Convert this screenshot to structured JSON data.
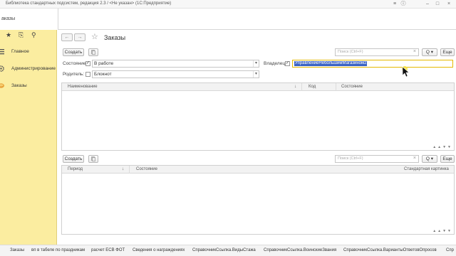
{
  "window": {
    "title": "Библиотека стандартных подсистем, редакция 2.3 / <Не указан> (1С:Предприятие)"
  },
  "tab": {
    "label": "аказы"
  },
  "sidebar": {
    "items": [
      {
        "label": "Главное",
        "icon": "menu-lines-icon"
      },
      {
        "label": "Администрирование",
        "icon": "gear-icon"
      },
      {
        "label": "Заказы",
        "icon": "orders-icon"
      }
    ]
  },
  "page": {
    "title": "Заказы",
    "create_label": "Создать",
    "search_placeholder": "Поиск (Ctrl+F)",
    "search_button": "Q",
    "more_label": "Еще"
  },
  "filters": {
    "state": {
      "label": "Состояние:",
      "checked": true,
      "value": "В работе"
    },
    "owner": {
      "label": "Владелец:",
      "checked": true,
      "value": "УправлениеНебольшимМагазином2"
    },
    "parent": {
      "label": "Родитель:",
      "checked": false,
      "value": "Блокнот"
    }
  },
  "table1": {
    "columns": [
      "Наименование",
      "Код",
      "Состояние"
    ]
  },
  "table2": {
    "create_label": "Создать",
    "search_placeholder": "Поиск (Ctrl+F)",
    "search_button": "Q",
    "more_label": "Еще",
    "columns": [
      "Период",
      "Состояние",
      "Стандартная картинка"
    ]
  },
  "bottom_links": [
    "Заказы",
    "вп в табеле по праздникам",
    "расчет ЕСВ ФОТ",
    "Сведения о награждениях",
    "СправочникСсылка.ВидыСтажа",
    "СправочникСсылка.ВоинскиеЗвания",
    "СправочникСсылка.ВариантыОтветовОпросов",
    "Спр"
  ],
  "colors": {
    "sidebar_bg": "#fbeda0",
    "selection": "#3b63c4",
    "active_field_border": "#e6b900"
  }
}
